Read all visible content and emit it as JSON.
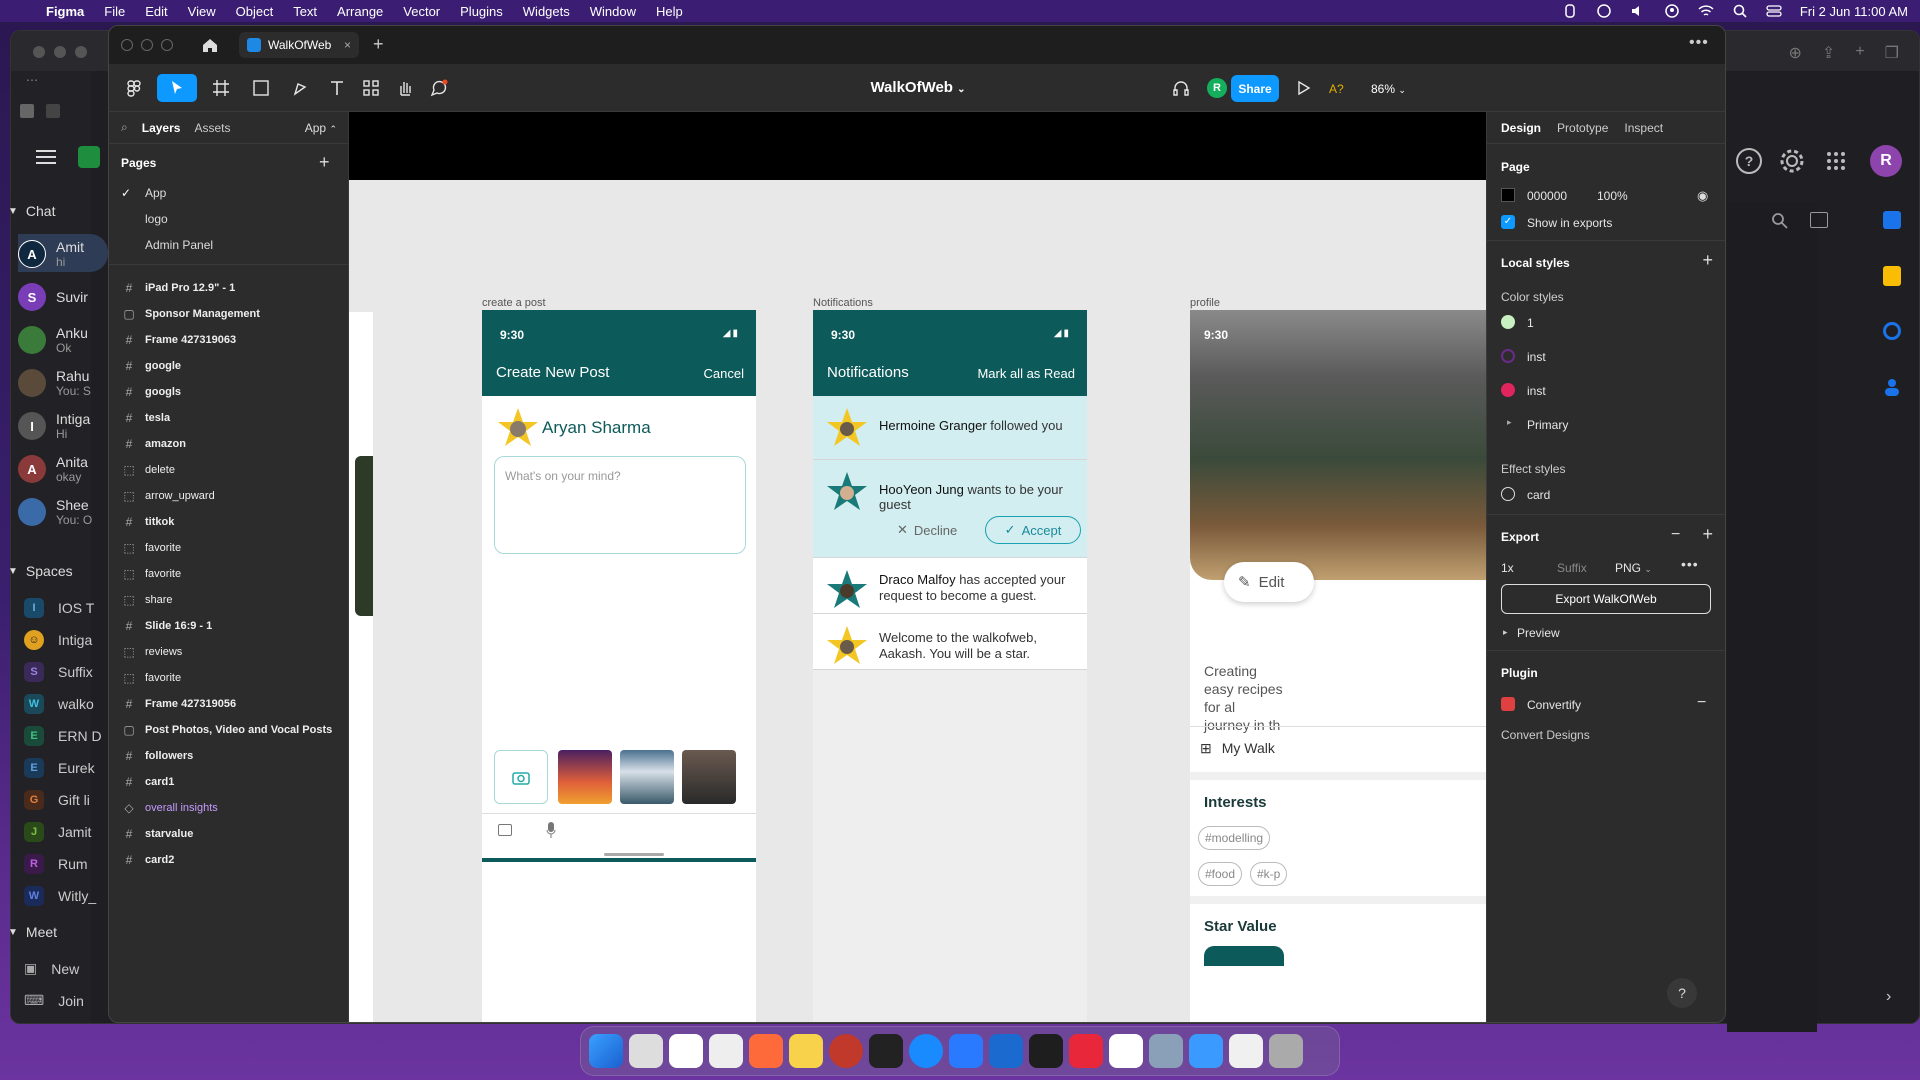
{
  "menubar": {
    "app": "Figma",
    "items": [
      "File",
      "Edit",
      "View",
      "Object",
      "Text",
      "Arrange",
      "Vector",
      "Plugins",
      "Widgets",
      "Window",
      "Help"
    ],
    "datetime": "Fri 2 Jun  11:00 AM"
  },
  "chat_app": {
    "chat_heading": "Chat",
    "chats": [
      {
        "name": "Amit",
        "sub": "hi",
        "avatar": "A",
        "color": "#1a3a5c"
      },
      {
        "name": "Suvir",
        "sub": "",
        "avatar": "S",
        "color": "#7a3db8"
      },
      {
        "name": "Anku",
        "sub": "Ok",
        "avatar": "",
        "color": "#3a7a3a"
      },
      {
        "name": "Rahu",
        "sub": "You: S",
        "avatar": "",
        "color": "#5a4a3a"
      },
      {
        "name": "Intiga",
        "sub": "Hi",
        "avatar": "I",
        "color": "#666"
      },
      {
        "name": "Anita",
        "sub": "okay",
        "avatar": "A",
        "color": "#8a3a3a"
      },
      {
        "name": "Shee",
        "sub": "You: O",
        "avatar": "",
        "color": "#3a6aa8"
      }
    ],
    "spaces_heading": "Spaces",
    "spaces": [
      {
        "name": "IOS T",
        "badge": "I",
        "color": "#1a4a6a",
        "fg": "#6ab0e0"
      },
      {
        "name": "Intiga",
        "badge": "☺",
        "color": "#e0a020",
        "fg": "#222"
      },
      {
        "name": "Suffix",
        "badge": "S",
        "color": "#3a2a5a",
        "fg": "#a080e0"
      },
      {
        "name": "walko",
        "badge": "W",
        "color": "#1a4a5a",
        "fg": "#40c0e0"
      },
      {
        "name": "ERN D",
        "badge": "E",
        "color": "#1a4a3a",
        "fg": "#40c080"
      },
      {
        "name": "Eurek",
        "badge": "E",
        "color": "#1a3a5a",
        "fg": "#60a0e0"
      },
      {
        "name": "Gift li",
        "badge": "G",
        "color": "#4a2a1a",
        "fg": "#e08040"
      },
      {
        "name": "Jamit",
        "badge": "J",
        "color": "#2a4a1a",
        "fg": "#80c040"
      },
      {
        "name": "Rum",
        "badge": "R",
        "color": "#3a1a4a",
        "fg": "#c060e0"
      },
      {
        "name": "Witly_",
        "badge": "W",
        "color": "#1a2a5a",
        "fg": "#6080e0"
      }
    ],
    "meet_heading": "Meet",
    "meet_items": [
      "New",
      "Join"
    ]
  },
  "figma": {
    "tab_title": "WalkOfWeb",
    "file_title": "WalkOfWeb",
    "share_label": "Share",
    "zoom": "86%",
    "user_initial": "R",
    "a_label": "A?",
    "layers_panel": {
      "tabs": [
        "Layers",
        "Assets"
      ],
      "page_selector": "App",
      "pages_heading": "Pages",
      "pages": [
        {
          "name": "App",
          "selected": true
        },
        {
          "name": "logo",
          "selected": false
        },
        {
          "name": "Admin Panel",
          "selected": false
        }
      ],
      "layers": [
        {
          "name": "iPad Pro 12.9\" - 1",
          "icon": "frame"
        },
        {
          "name": "Sponsor Management",
          "icon": "section"
        },
        {
          "name": "Frame 427319063",
          "icon": "frame"
        },
        {
          "name": "google",
          "icon": "frame"
        },
        {
          "name": "googls",
          "icon": "frame"
        },
        {
          "name": "tesla",
          "icon": "frame"
        },
        {
          "name": "amazon",
          "icon": "frame"
        },
        {
          "name": "delete",
          "icon": "dashed"
        },
        {
          "name": "arrow_upward",
          "icon": "dashed"
        },
        {
          "name": "titkok",
          "icon": "frame"
        },
        {
          "name": "favorite",
          "icon": "dashed"
        },
        {
          "name": "favorite",
          "icon": "dashed"
        },
        {
          "name": "share",
          "icon": "dashed"
        },
        {
          "name": "Slide 16:9 - 1",
          "icon": "frame"
        },
        {
          "name": "reviews",
          "icon": "dashed"
        },
        {
          "name": "favorite",
          "icon": "dashed"
        },
        {
          "name": "Frame 427319056",
          "icon": "frame"
        },
        {
          "name": "Post Photos, Video and Vocal Posts",
          "icon": "section"
        },
        {
          "name": "followers",
          "icon": "frame"
        },
        {
          "name": "card1",
          "icon": "frame"
        },
        {
          "name": "overall insights",
          "icon": "component"
        },
        {
          "name": "starvalue",
          "icon": "frame"
        },
        {
          "name": "card2",
          "icon": "frame"
        }
      ]
    },
    "canvas": {
      "frame_labels": {
        "create_post": "create a post",
        "notifications": "Notifications",
        "profile": "profile"
      },
      "create_post": {
        "time": "9:30",
        "title": "Create New Post",
        "cancel": "Cancel",
        "user_name": "Aryan Sharma",
        "placeholder": "What's on your mind?"
      },
      "notifications": {
        "time": "9:30",
        "title": "Notifications",
        "mark_all": "Mark all as Read",
        "items": [
          {
            "actor": "Hermoine Granger",
            "text": "followed you"
          },
          {
            "actor": "HooYeon Jung",
            "text": "wants to be your guest"
          },
          {
            "actor": "Draco Malfoy",
            "text": "has accepted your request to become a guest."
          },
          {
            "actor": "",
            "text": "Welcome to the walkofweb, Aakash. You will be a star."
          }
        ],
        "decline": "Decline",
        "accept": "Accept"
      },
      "profile": {
        "time": "9:30",
        "edit": "Edit",
        "bio": "Creating easy recipes for al journey in th",
        "my_walk": "My Walk",
        "interests_heading": "Interests",
        "tags": [
          "#modelling",
          "#food",
          "#k-p"
        ],
        "star_value": "Star Value"
      }
    },
    "design_panel": {
      "tabs": [
        "Design",
        "Prototype",
        "Inspect"
      ],
      "page_heading": "Page",
      "page_color": "000000",
      "page_opacity": "100%",
      "show_in_exports": "Show in exports",
      "local_styles": "Local styles",
      "color_styles_heading": "Color styles",
      "color_styles": [
        {
          "name": "1",
          "color": "#c8f0c0"
        },
        {
          "name": "inst",
          "color": "#6a2a8a"
        },
        {
          "name": "inst",
          "color": "#e0245e"
        }
      ],
      "primary_group": "Primary",
      "effect_styles_heading": "Effect styles",
      "effect_style": "card",
      "export_heading": "Export",
      "export_scale": "1x",
      "export_suffix": "Suffix",
      "export_format": "PNG",
      "export_button": "Export WalkOfWeb",
      "preview": "Preview",
      "plugin_heading": "Plugin",
      "plugin_name": "Convertify",
      "plugin_action": "Convert Designs"
    }
  }
}
